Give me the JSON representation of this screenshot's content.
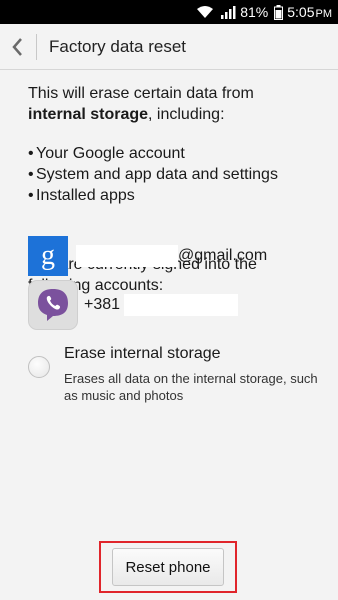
{
  "status_bar": {
    "battery": "81%",
    "time": "5:05",
    "time_suffix": "PM"
  },
  "header": {
    "title": "Factory data reset"
  },
  "content": {
    "intro_line1": "This will erase certain data from",
    "intro_bold": "internal storage",
    "intro_rest": ", including:",
    "bullets": [
      "Your Google account",
      "System and app data and settings",
      "Installed apps"
    ],
    "signed_in_text": "You are currently signed into the following accounts:"
  },
  "accounts": {
    "google": {
      "label_suffix": "@gmail.com",
      "icon": "google-icon"
    },
    "viber": {
      "label_prefix": "+381",
      "icon": "viber-icon"
    }
  },
  "erase_option": {
    "title": "Erase internal storage",
    "description": "Erases all data on the internal storage, such as music and photos",
    "checked": false
  },
  "actions": {
    "reset_label": "Reset phone"
  },
  "colors": {
    "highlight_border": "#e0252b",
    "google_blue": "#1d72d8",
    "viber_purple": "#7b519d"
  }
}
